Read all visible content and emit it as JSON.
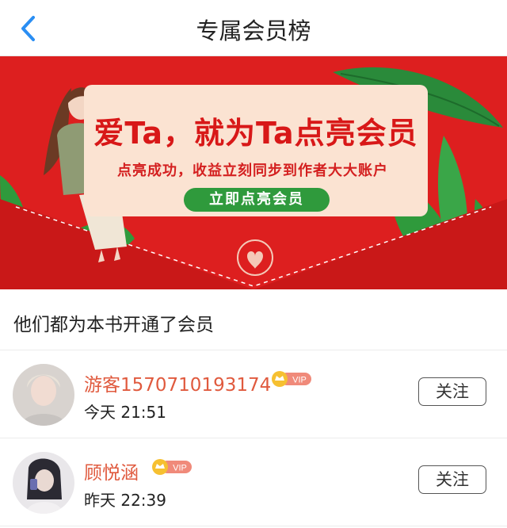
{
  "header": {
    "title": "专属会员榜"
  },
  "banner": {
    "headline": "爱Ta，就为Ta点亮会员",
    "subtext": "点亮成功，收益立刻同步到作者大大账户",
    "cta_label": "立即点亮会员",
    "colors": {
      "background": "#dd1f1f",
      "card": "#fbe3d2",
      "cta": "#2f9a3c"
    }
  },
  "section": {
    "title": "他们都为本书开通了会员"
  },
  "members": [
    {
      "name": "游客1570710193174",
      "badge": "VIP",
      "time": "今天 21:51",
      "follow_label": "关注"
    },
    {
      "name": "顾悦涵",
      "badge": "VIP",
      "time": "昨天 22:39",
      "follow_label": "关注"
    }
  ]
}
